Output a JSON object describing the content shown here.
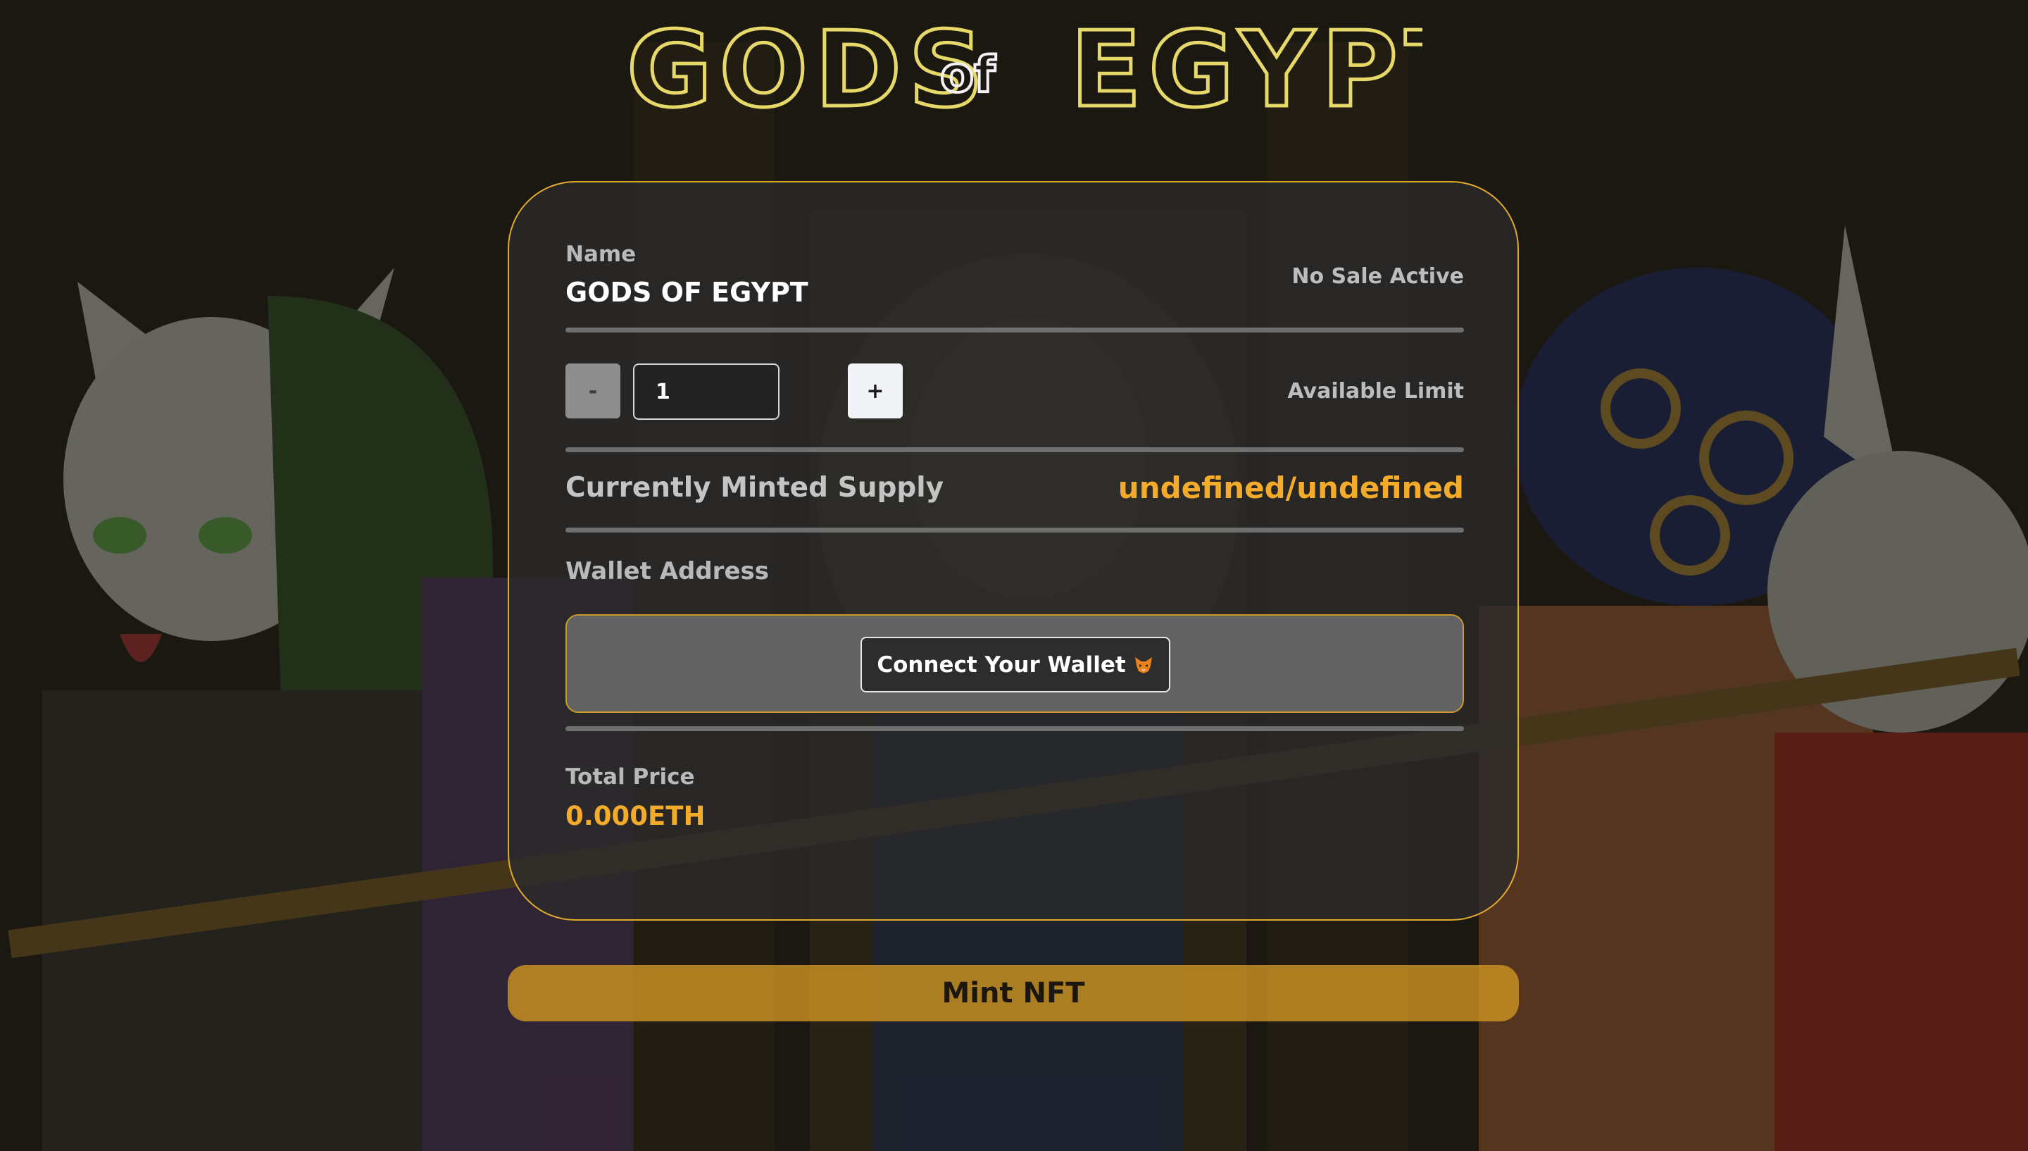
{
  "logo": {
    "alt": "Gods of Egypt",
    "word1": "GODS",
    "word2": "of",
    "word3": "EGYPT"
  },
  "card": {
    "name_label": "Name",
    "name_value": "GODS OF EGYPT",
    "sale_status": "No Sale Active",
    "quantity": {
      "minus_label": "-",
      "value": "1",
      "plus_label": "+"
    },
    "available_limit_label": "Available Limit",
    "supply_label": "Currently Minted Supply",
    "supply_value": "undefined/undefined",
    "wallet_address_label": "Wallet Address",
    "connect_label": "Connect Your Wallet",
    "connect_icon": "fox-icon",
    "total_price_label": "Total Price",
    "total_price_value": "0.000ETH"
  },
  "mint_button_label": "Mint NFT",
  "colors": {
    "accent": "#f5ab2a",
    "border": "#e2a92c",
    "mint": "#cc9222",
    "card_bg": "#2a2a2a"
  }
}
